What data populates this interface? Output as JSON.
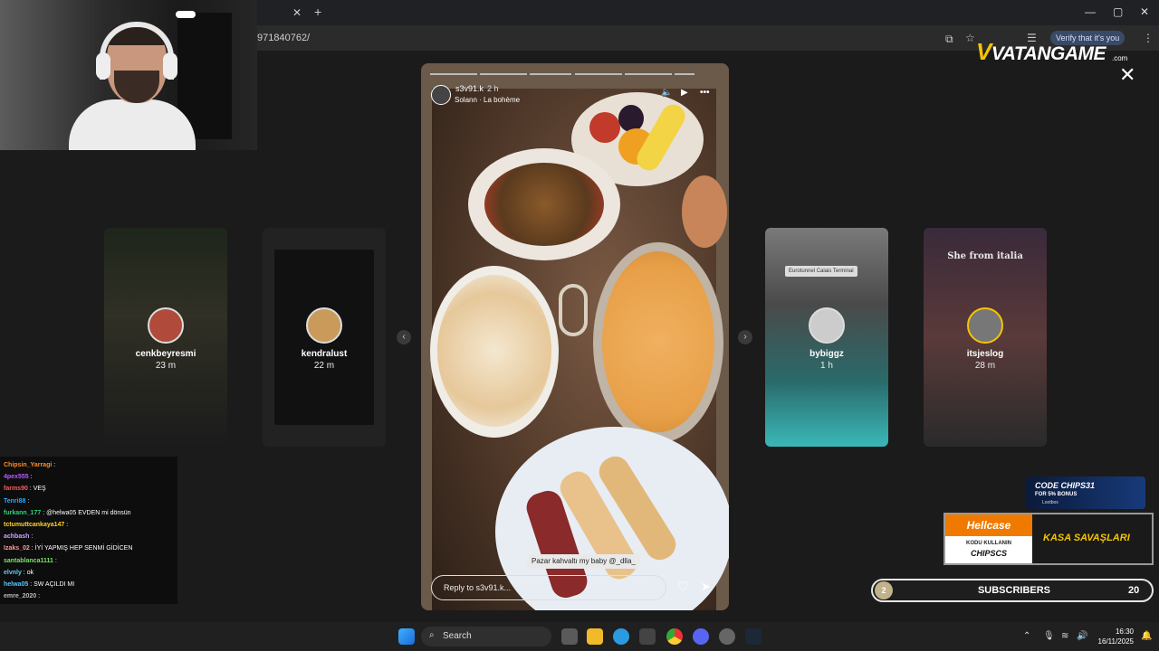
{
  "browser": {
    "url_fragment": "971840762/",
    "verify_text": "Verify that it's you"
  },
  "story": {
    "username": "s3v91.k",
    "time": "2 h",
    "music": "Solann · La bohème",
    "caption": "Pazar kahvaltı my baby @_dlla_",
    "reply_placeholder": "Reply to s3v91.k..."
  },
  "side_stories": [
    {
      "username": "cenkbeyresmi",
      "time": "23 m"
    },
    {
      "username": "kendralust",
      "time": "22 m"
    },
    {
      "username": "bybiggz",
      "time": "1 h"
    },
    {
      "username": "itsjeslog",
      "time": "28 m"
    }
  ],
  "side_story_texts": {
    "eurotunnel": "Eurotunnel Calais Terminal",
    "she_from": "She from italia"
  },
  "overlay": {
    "logo": "VATANGAME",
    "logo_domain": ".com",
    "code_ad": {
      "line1": "CODE CHIPS31",
      "line2": "FOR 5% BONUS",
      "line3": "Lootbox"
    },
    "hellcase": {
      "brand": "Hellcase",
      "line1": "KODU KULLANIN",
      "line2": "CHIPSCS",
      "right": "KASA SAVAŞLARI"
    },
    "subscribers": {
      "label": "SUBSCRIBERS",
      "left_count": "2",
      "right_count": "20"
    }
  },
  "chat": [
    {
      "user": "Chipsin_Yarragi",
      "msg": "",
      "color": "#ff8c2a"
    },
    {
      "user": "4pex555",
      "msg": "",
      "color": "#b85cff"
    },
    {
      "user": "farms90",
      "msg": "VEŞ",
      "color": "#ff5a5a"
    },
    {
      "user": "Tenri88",
      "msg": "",
      "color": "#2aa9ff"
    },
    {
      "user": "furkann_177",
      "msg": "@helwa05 EVDEN mi dönsün",
      "color": "#34d17a"
    },
    {
      "user": "tctumuttcankaya147",
      "msg": "",
      "color": "#ffd12a"
    },
    {
      "user": "achbash",
      "msg": "",
      "color": "#c9a3ff"
    },
    {
      "user": "Izaks_02",
      "msg": "İYİ YAPMIŞ HEP SENMİ GİDİCEN",
      "color": "#ff9a9a"
    },
    {
      "user": "santablanca1111",
      "msg": "",
      "color": "#7ce36a"
    },
    {
      "user": "elvnly",
      "msg": "ok",
      "color": "#5ad0ff"
    },
    {
      "user": "helwa05",
      "msg": "SW AÇILDI MI",
      "color": "#5ac8ff"
    },
    {
      "user": "emre_2020",
      "msg": "",
      "color": "#bbbbbb"
    }
  ],
  "taskbar": {
    "search_label": "Search",
    "time": "16:30",
    "date": "16/11/2025"
  }
}
